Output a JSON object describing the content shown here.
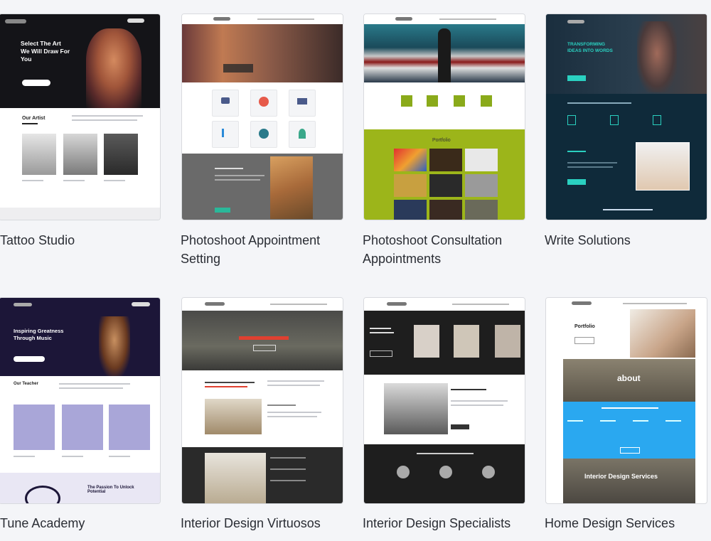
{
  "templates": [
    {
      "title": "Tattoo Studio",
      "hero_heading": "Select The Art We Will Draw For You",
      "section_heading": "Our Artist"
    },
    {
      "title": "Photoshoot Appointment Setting"
    },
    {
      "title": "Photoshoot Consultation Appointments",
      "section_heading": "Portfolio"
    },
    {
      "title": "Write Solutions",
      "hero_heading": "TRANSFORMING IDEAS INTO WORDS"
    },
    {
      "title": "Tune Academy",
      "hero_heading": "Inspiring Greatness Through Music",
      "section_heading": "Our Teacher",
      "footer_heading": "The Passion To Unlock Potential"
    },
    {
      "title": "Interior Design Virtuosos"
    },
    {
      "title": "Interior Design Specialists"
    },
    {
      "title": "Home Design Services",
      "section_heading": "Portfolio",
      "banner_heading": "about",
      "bottom_heading": "Interior Design Services"
    }
  ]
}
